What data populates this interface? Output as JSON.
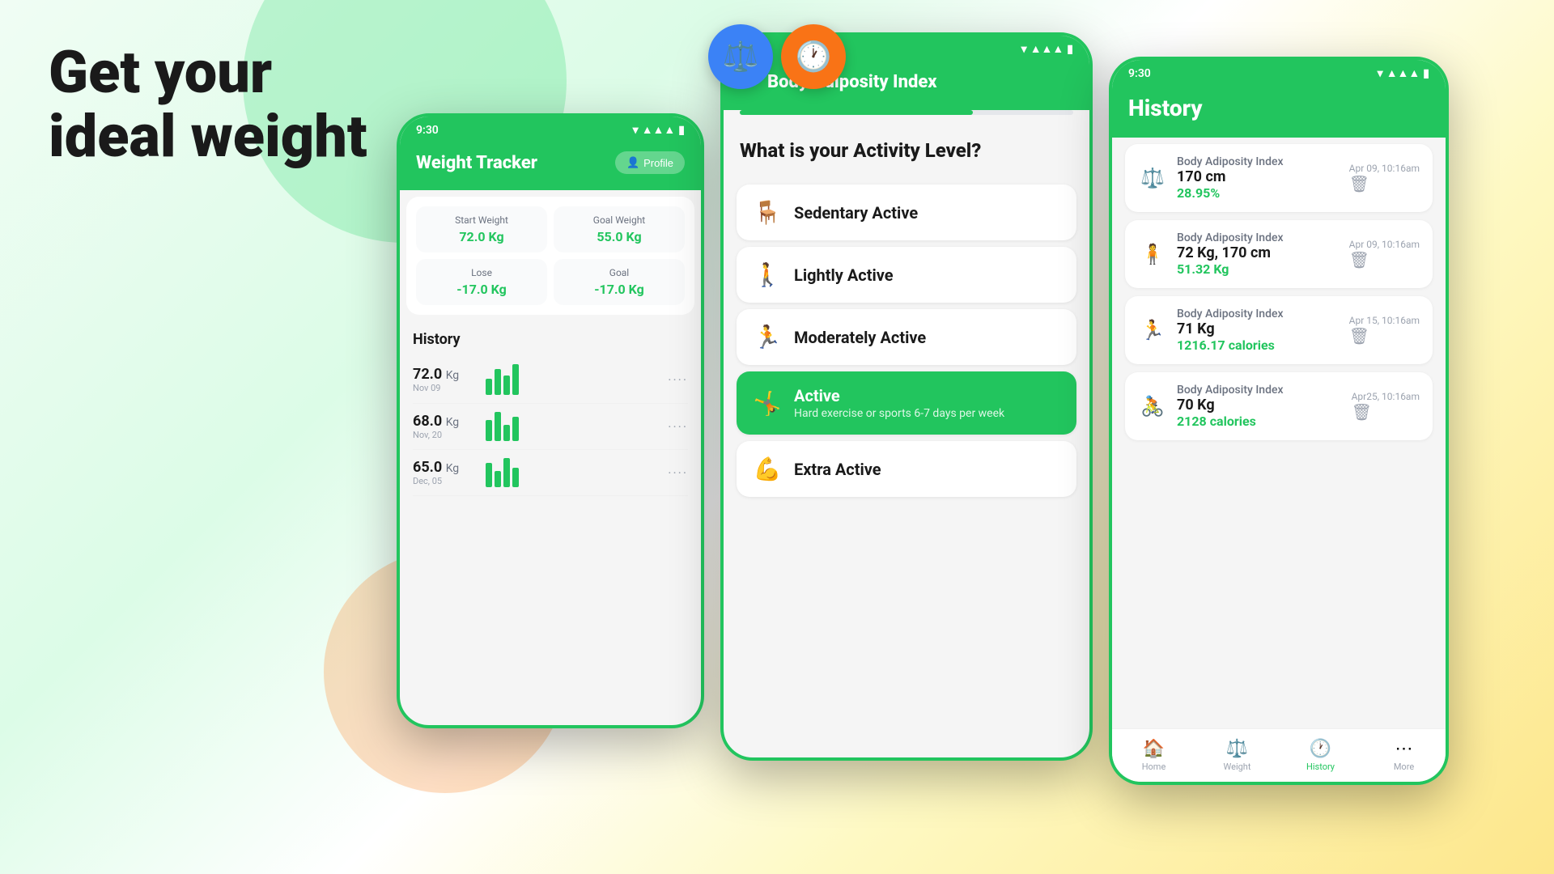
{
  "hero": {
    "title_line1": "Get your",
    "title_line2": "ideal weight"
  },
  "app_icons": [
    {
      "name": "scale-app",
      "emoji": "⚖️",
      "color": "blue"
    },
    {
      "name": "history-app",
      "emoji": "🕐",
      "color": "orange"
    }
  ],
  "phone1": {
    "status_time": "9:30",
    "title": "Weight Tracker",
    "profile_btn": "Profile",
    "stats": [
      {
        "label": "Start Weight",
        "value": "72.0 Kg"
      },
      {
        "label": "Goal Weight",
        "value": "55.0 Kg"
      },
      {
        "label": "Lose",
        "value": "-17.0 Kg"
      },
      {
        "label": "Goal",
        "value": "-17.0 Kg"
      }
    ],
    "history_title": "History",
    "history_items": [
      {
        "weight": "72.0",
        "unit": "Kg",
        "date": "Nov 09",
        "bars": [
          20,
          30,
          25,
          35
        ]
      },
      {
        "weight": "68.0",
        "unit": "Kg",
        "date": "Nov, 20",
        "bars": [
          25,
          35,
          20,
          30
        ]
      },
      {
        "weight": "65.0",
        "unit": "Kg",
        "date": "Dec, 05",
        "bars": [
          30,
          20,
          35,
          25
        ]
      }
    ]
  },
  "phone2": {
    "status_time": "9:30",
    "title": "Body Adiposity Index",
    "back_label": "←",
    "question": "What is your Activity Level?",
    "progress": 70,
    "options": [
      {
        "name": "Sedentary Active",
        "icon": "🪑",
        "desc": "",
        "active": false
      },
      {
        "name": "Lightly Active",
        "icon": "🚶",
        "desc": "",
        "active": false
      },
      {
        "name": "Moderately Active",
        "icon": "🏃",
        "desc": "",
        "active": false
      },
      {
        "name": "Active",
        "icon": "🤸",
        "desc": "Hard exercise or sports 6-7 days per week",
        "active": true
      },
      {
        "name": "Extra Active",
        "icon": "💪",
        "desc": "",
        "active": false
      }
    ]
  },
  "phone3": {
    "status_time": "9:30",
    "title": "History",
    "records": [
      {
        "icon": "⚖️",
        "title": "Body Adiposity Index",
        "main": "170 cm",
        "sub": "28.95%",
        "date": "Apr 09, 10:16am"
      },
      {
        "icon": "🧍",
        "title": "Body Adiposity Index",
        "main": "72 Kg, 170 cm",
        "sub": "51.32 Kg",
        "date": "Apr 09, 10:16am"
      },
      {
        "icon": "🏃",
        "title": "Body Adiposity Index",
        "main": "71 Kg",
        "sub": "1216.17 calories",
        "date": "Apr 15, 10:16am"
      },
      {
        "icon": "🚴",
        "title": "Body Adiposity Index",
        "main": "70 Kg",
        "sub": "2128 calories",
        "date": "Apr25, 10:16am"
      }
    ],
    "nav": [
      {
        "label": "Home",
        "icon": "🏠",
        "active": false
      },
      {
        "label": "Weight",
        "icon": "⚖️",
        "active": false
      },
      {
        "label": "History",
        "icon": "🕐",
        "active": true
      },
      {
        "label": "More",
        "icon": "⋯",
        "active": false
      }
    ]
  }
}
